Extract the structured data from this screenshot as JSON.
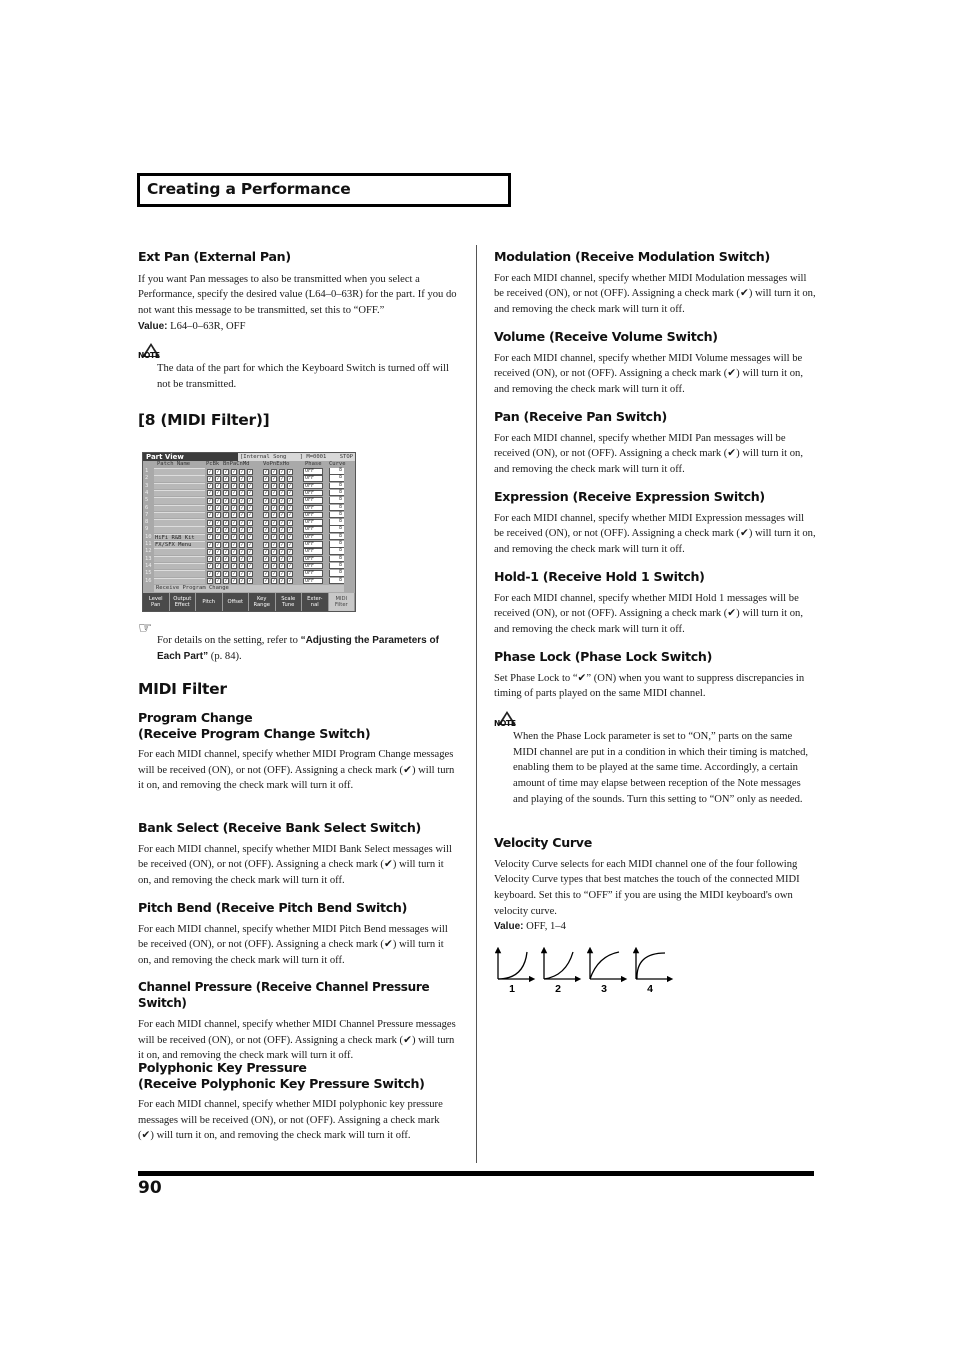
{
  "header": {
    "chapter_title": "Creating a Performance"
  },
  "left": {
    "ext_pan": {
      "heading": "Ext Pan (External Pan)",
      "body": "If you want Pan messages to also be transmitted when you select a Performance, specify the desired value (L64–0–63R) for the part. If you do not want this message to be transmitted, set this to “OFF.”",
      "value_label": "Value:",
      "value": " L64–0–63R, OFF",
      "note_icon_label": "NOTE",
      "note": "The data of the part for which the Keyboard Switch is turned off will not be transmitted."
    },
    "section_title": "[8 (MIDI Filter)]",
    "screen": {
      "title": "Part View",
      "status_song": "[Internal Song",
      "status_measure": "] M=0001",
      "status_state": "STOP",
      "col_patch_name": "Patch Name",
      "col_group1": "PcBk",
      "col_group2": "BnPaCnMd",
      "col_group3": "VoPnExHo",
      "col_phase": "Phase",
      "col_curve": "Curve",
      "rows": [
        {
          "num": "1",
          "name": "",
          "phase": "OFF",
          "curve": "8"
        },
        {
          "num": "2",
          "name": "",
          "phase": "OFF",
          "curve": "8"
        },
        {
          "num": "3",
          "name": "",
          "phase": "OFF",
          "curve": "8"
        },
        {
          "num": "4",
          "name": "",
          "phase": "OFF",
          "curve": "8"
        },
        {
          "num": "5",
          "name": "",
          "phase": "OFF",
          "curve": "8"
        },
        {
          "num": "6",
          "name": "",
          "phase": "OFF",
          "curve": "8"
        },
        {
          "num": "7",
          "name": "",
          "phase": "OFF",
          "curve": "8"
        },
        {
          "num": "8",
          "name": "",
          "phase": "OFF",
          "curve": "8"
        },
        {
          "num": "9",
          "name": "",
          "phase": "OFF",
          "curve": "8"
        },
        {
          "num": "10",
          "name": "HiFi R&B Kit",
          "phase": "OFF",
          "curve": "8"
        },
        {
          "num": "11",
          "name": "FX/SFX Menu",
          "phase": "OFF",
          "curve": "8"
        },
        {
          "num": "12",
          "name": "",
          "phase": "OFF",
          "curve": "8"
        },
        {
          "num": "13",
          "name": "",
          "phase": "OFF",
          "curve": "8"
        },
        {
          "num": "14",
          "name": "",
          "phase": "OFF",
          "curve": "8"
        },
        {
          "num": "15",
          "name": "",
          "phase": "OFF",
          "curve": "8"
        },
        {
          "num": "16",
          "name": "",
          "phase": "OFF",
          "curve": "8"
        }
      ],
      "footer": "Receive Program Change",
      "tabs": [
        {
          "label": "Level\nPan"
        },
        {
          "label": "Output\nEffect"
        },
        {
          "label": "Pitch"
        },
        {
          "label": "Offset"
        },
        {
          "label": "Key\nRange"
        },
        {
          "label": "Scale\nTune"
        },
        {
          "label": "Exter-\nnal"
        },
        {
          "label": "MIDI\nFilter"
        }
      ]
    },
    "ref": {
      "icon": "pointing-hand-icon",
      "text_before": "For details on the setting, refer to ",
      "link": "“Adjusting the Parameters of Each Part”",
      "text_after": " (p. 84)."
    },
    "midi_filter_title": "MIDI Filter",
    "program_change": {
      "heading_line1": "Program Change",
      "heading_line2": "(Receive Program Change Switch)",
      "body": "For each MIDI channel, specify whether MIDI Program Change messages will be received (ON), or not (OFF). Assigning a check mark (✔) will turn it on, and removing the check mark will turn it off."
    },
    "bank_select": {
      "heading": "Bank Select (Receive Bank Select Switch)",
      "body": "For each MIDI channel, specify whether MIDI Bank Select messages will be received (ON), or not (OFF). Assigning a check mark (✔) will turn it on, and removing the check mark will turn it off."
    },
    "pitch_bend": {
      "heading": "Pitch Bend (Receive Pitch Bend Switch)",
      "body": "For each MIDI channel, specify whether MIDI Pitch Bend messages will be received (ON), or not (OFF). Assigning a check mark (✔) will turn it on, and removing the check mark will turn it off."
    },
    "channel_pressure": {
      "heading": "Channel Pressure (Receive Channel Pressure Switch)",
      "body": "For each MIDI channel, specify whether MIDI Channel Pressure messages will be received (ON), or not (OFF). Assigning a check mark (✔) will turn it on, and removing the check mark will turn it off."
    },
    "poly_key_pressure": {
      "heading_line1": "Polyphonic Key Pressure",
      "heading_line2": "(Receive Polyphonic Key Pressure Switch)",
      "body": "For each MIDI channel, specify whether MIDI polyphonic key pressure messages will be received (ON), or not (OFF). Assigning a check mark (✔) will turn it on, and removing the check mark will turn it off."
    }
  },
  "right": {
    "modulation": {
      "heading": "Modulation (Receive Modulation Switch)",
      "body": "For each MIDI channel, specify whether MIDI Modulation messages will be received (ON), or not (OFF). Assigning a check mark (✔) will turn it on, and removing the check mark will turn it off."
    },
    "volume": {
      "heading": "Volume (Receive Volume Switch)",
      "body": "For each MIDI channel, specify whether MIDI Volume messages will be received (ON), or not (OFF). Assigning a check mark (✔) will turn it on, and removing the check mark will turn it off."
    },
    "pan": {
      "heading": "Pan (Receive Pan Switch)",
      "body": "For each MIDI channel, specify whether MIDI Pan messages will be received (ON), or not (OFF). Assigning a check mark (✔) will turn it on, and removing the check mark will turn it off."
    },
    "expression": {
      "heading": "Expression (Receive Expression Switch)",
      "body": "For each MIDI channel, specify whether MIDI Expression messages will be received (ON), or not (OFF). Assigning a check mark (✔) will turn it on, and removing the check mark will turn it off."
    },
    "hold1": {
      "heading": "Hold-1 (Receive Hold 1 Switch)",
      "body": "For each MIDI channel, specify whether MIDI Hold 1 messages will be received (ON), or not (OFF). Assigning a check mark (✔) will turn it on, and removing the check mark will turn it off."
    },
    "phase_lock": {
      "heading": "Phase Lock (Phase Lock Switch)",
      "body": "Set Phase Lock to “✔” (ON) when you want to suppress discrepancies in timing of parts played on the same MIDI channel.",
      "note_icon_label": "NOTE",
      "note": "When the Phase Lock parameter is set to “ON,” parts on the same MIDI channel are put in a condition in which their timing is matched, enabling them to be played at the same time. Accordingly, a certain amount of time may elapse between reception of the Note messages and playing of the sounds. Turn this setting to “ON” only as needed."
    },
    "velocity_curve": {
      "heading": "Velocity Curve",
      "body": "Velocity Curve selects for each MIDI channel one of the four following Velocity Curve types that best matches the touch of the connected MIDI keyboard. Set this to “OFF” if you are using the MIDI keyboard's own velocity curve.",
      "value_label": "Value:",
      "value": " OFF, 1–4",
      "curve_labels": [
        "1",
        "2",
        "3",
        "4"
      ]
    }
  },
  "footer": {
    "page_number": "90"
  }
}
